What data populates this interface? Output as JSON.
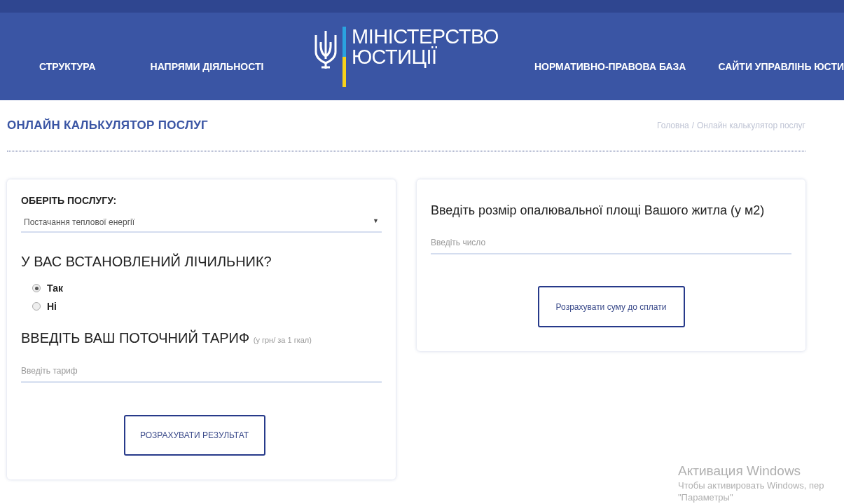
{
  "header": {
    "nav_left": [
      "СТРУКТУРА",
      "НАПРЯМИ ДІЯЛЬНОСТІ"
    ],
    "logo": {
      "line1": "МІНІСТЕРСТВО",
      "line2": "ЮСТИЦІЇ"
    },
    "nav_right": [
      "НОРМАТИВНО-ПРАВОВА БАЗА",
      "САЙТИ УПРАВЛІНЬ ЮСТИ"
    ]
  },
  "page_title": "ОНЛАЙН КАЛЬКУЛЯТОР ПОСЛУГ",
  "breadcrumb": {
    "items": [
      "Головна",
      "Онлайн калькулятор послуг"
    ],
    "separator": "/"
  },
  "left_card": {
    "service_label": "ОБЕРІТЬ ПОСЛУГУ:",
    "service_select": {
      "value": "Постачання теплової енергії",
      "caret": "▼"
    },
    "meter_question": "У ВАС ВСТАНОВЛЕНИЙ ЛІЧИЛЬНИК?",
    "meter_options": [
      {
        "label": "Так",
        "selected": true
      },
      {
        "label": "Ні",
        "selected": false
      }
    ],
    "tariff_heading": "ВВЕДІТЬ ВАШ ПОТОЧНИЙ ТАРИФ",
    "tariff_unit": "(у грн/ за 1 гкал)",
    "tariff_input": {
      "placeholder": "Введіть тариф"
    },
    "button": "РОЗРАХУВАТИ РЕЗУЛЬТАТ"
  },
  "right_card": {
    "area_label": "Введіть розмір опалювальної площі Вашого житла (у м2)",
    "area_input": {
      "placeholder": "Введіть число"
    },
    "button": "Розрахувати суму до сплати"
  },
  "activation": {
    "title": "Активация Windows",
    "lines": [
      "Чтобы активировать Windows, пер",
      "\"Параметры\""
    ]
  }
}
